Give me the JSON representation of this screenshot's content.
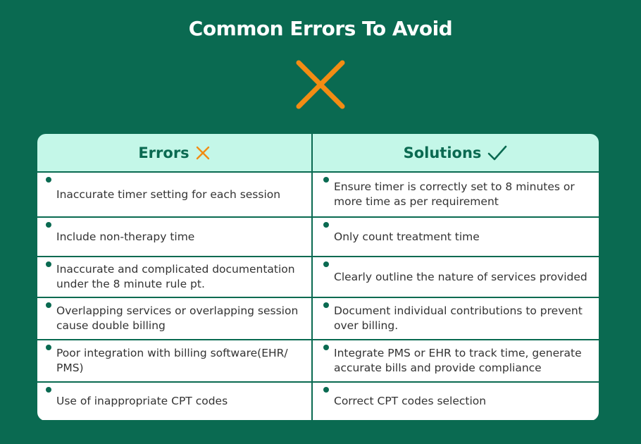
{
  "title": "Common Errors To Avoid",
  "colors": {
    "background": "#0a6a51",
    "header_bg": "#c4f7e8",
    "accent_orange": "#f28c13",
    "text_dark": "#333333"
  },
  "table": {
    "headers": {
      "errors": {
        "label": "Errors",
        "icon": "x-icon"
      },
      "solutions": {
        "label": "Solutions",
        "icon": "check-icon"
      }
    },
    "rows": [
      {
        "error": "Inaccurate timer setting for each session",
        "solution": "Ensure timer is correctly set to 8 minutes or more time as per requirement"
      },
      {
        "error": "Include non-therapy time",
        "solution": "Only count treatment time"
      },
      {
        "error": "Inaccurate and complicated documentation under the 8 minute rule pt.",
        "solution": "Clearly outline the nature of services provided"
      },
      {
        "error": "Overlapping services or overlapping session cause double billing",
        "solution": "Document individual contributions to prevent over billing."
      },
      {
        "error": "Poor integration with billing software(EHR/ PMS)",
        "solution": "Integrate PMS or EHR to track time, generate accurate bills and provide compliance"
      },
      {
        "error": "Use of inappropriate CPT codes",
        "solution": "Correct CPT codes selection"
      }
    ]
  }
}
